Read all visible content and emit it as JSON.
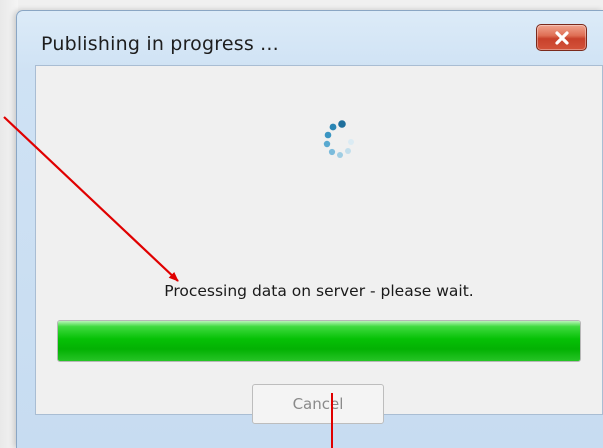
{
  "dialog": {
    "title": "Publishing in progress ...",
    "close_icon": "close-icon",
    "spinner_icon": "loading-spinner-icon",
    "status_text": "Processing data on server - please wait.",
    "progress_percent": 100,
    "cancel_label": "Cancel",
    "cancel_enabled": false
  },
  "colors": {
    "progress_fill": "#06c106",
    "close_button": "#c8412b",
    "annotation_arrow": "#e00000"
  }
}
